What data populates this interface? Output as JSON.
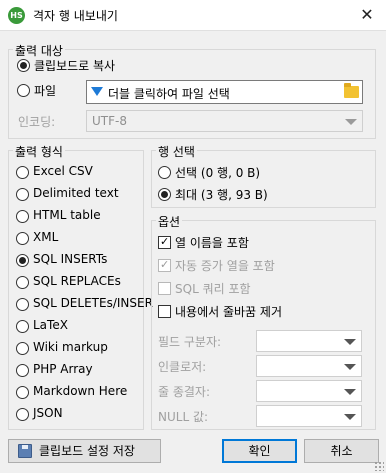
{
  "window": {
    "title": "격자 행 내보내기",
    "icon_text": "HS"
  },
  "destination": {
    "legend": "출력 대상",
    "clipboard_label": "클립보드로 복사",
    "file_label": "파일",
    "file_placeholder": "더블 클릭하여 파일 선택",
    "encoding_label": "인코딩:",
    "encoding_value": "UTF-8"
  },
  "format": {
    "legend": "출력 형식",
    "options": [
      "Excel CSV",
      "Delimited text",
      "HTML table",
      "XML",
      "SQL INSERTs",
      "SQL REPLACEs",
      "SQL DELETEs/INSER",
      "LaTeX",
      "Wiki markup",
      "PHP Array",
      "Markdown Here",
      "JSON"
    ],
    "selected": "SQL INSERTs"
  },
  "rows": {
    "legend": "행 선택",
    "selection_label": "선택 (0 행, 0 B)",
    "all_label": "최대 (3 행, 93 B)",
    "selected": "최대 (3 행, 93 B)"
  },
  "options": {
    "legend": "옵션",
    "include_column_names": {
      "label": "열 이름을 포함",
      "checked": true,
      "enabled": true
    },
    "include_auto_increment": {
      "label": "자동 증가 열을 포함",
      "checked": true,
      "enabled": false
    },
    "include_sql_query": {
      "label": "SQL 쿼리 포함",
      "checked": false,
      "enabled": false
    },
    "remove_linebreaks": {
      "label": "내용에서 줄바꿈 제거",
      "checked": false,
      "enabled": true
    },
    "field_separator_label": "필드 구분자:",
    "encloser_label": "인클로저:",
    "line_terminator_label": "줄 종결자:",
    "null_value_label": "NULL 값:"
  },
  "buttons": {
    "save_settings": "클립보드 설정 저장",
    "ok": "확인",
    "cancel": "취소"
  }
}
